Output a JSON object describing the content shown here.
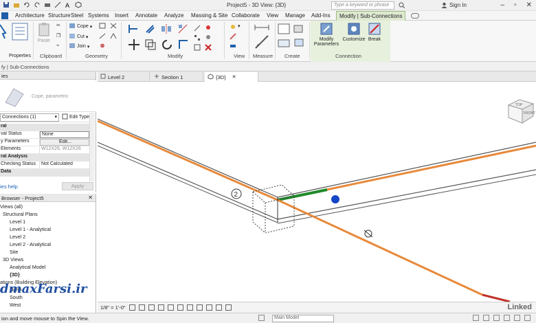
{
  "title_bar": {
    "document_title": "Project5 - 3D View: {3D}",
    "search_placeholder": "Type a keyword or phrase",
    "sign_in": "Sign In"
  },
  "ribbon_tabs": [
    "Architecture",
    "Structure",
    "Steel",
    "Systems",
    "Insert",
    "Annotate",
    "Analyze",
    "Massing & Site",
    "Collaborate",
    "View",
    "Manage",
    "Add-Ins",
    "Modify | Sub-Connections"
  ],
  "ribbon": {
    "properties_label": "Properties",
    "clipboard": {
      "paste": "Paste",
      "group": "Clipboard"
    },
    "geometry": {
      "cope": "Cope",
      "cut": "Cut",
      "join": "Join",
      "group": "Geometry"
    },
    "modify_group": "Modify",
    "view_group": "View",
    "measure_group": "Measure",
    "create_group": "Create",
    "connection": {
      "modify_parameters_1": "Modify",
      "modify_parameters_2": "Parameters",
      "customize": "Customize",
      "break": "Break",
      "group": "Connection"
    }
  },
  "context_bar": "fy | Sub-Connections",
  "properties": {
    "header": "ies",
    "type_name": "Cope, parametric",
    "instance_selector": "Connections (1)",
    "edit_type": "Edit Type",
    "rows": [
      {
        "section": true,
        "key": "ral"
      },
      {
        "key": "val Status",
        "value": "None",
        "style": "boxed"
      },
      {
        "key": "y Parameters",
        "value": "Edit...",
        "style": "btn"
      },
      {
        "key": "Elements",
        "value": "W12X26, W12X26",
        "style": "gray"
      },
      {
        "section": true,
        "key": "ral Analysis"
      },
      {
        "key": "Checking Status",
        "value": "Not Calculated",
        "style": ""
      },
      {
        "section": true,
        "key": "Data"
      }
    ],
    "help_link": "ies help",
    "apply": "Apply"
  },
  "project_browser": {
    "header": "Browser - Project5",
    "items": [
      {
        "label": "Views (all)",
        "level": "l0"
      },
      {
        "label": "Structural Plans",
        "level": "l1"
      },
      {
        "label": "Level 1",
        "level": "l2"
      },
      {
        "label": "Level 1 - Analytical",
        "level": "l2"
      },
      {
        "label": "Level 2",
        "level": "l2"
      },
      {
        "label": "Level 2 - Analytical",
        "level": "l2"
      },
      {
        "label": "Site",
        "level": "l2"
      },
      {
        "label": "3D Views",
        "level": "l1"
      },
      {
        "label": "Analytical Model",
        "level": "l2"
      },
      {
        "label": "{3D}",
        "level": "l2 bold"
      },
      {
        "label": "ations (Building Elevation)",
        "level": "l0"
      },
      {
        "label": "North",
        "level": "l2"
      },
      {
        "label": "South",
        "level": "l2"
      },
      {
        "label": "West",
        "level": "l2"
      }
    ],
    "watermark": "dmaxFarsi.ir"
  },
  "view_tabs": [
    {
      "label": "Level 2",
      "active": false
    },
    {
      "label": "Section 1",
      "active": false
    },
    {
      "label": "{3D}",
      "active": true
    }
  ],
  "view": {
    "viewcube_top": "TOP",
    "viewcube_front": "FRONT",
    "tag_number": "2"
  },
  "view_control": {
    "scale": "1/8\" = 1'-0\"",
    "linkedin": "Linked"
  },
  "status_bar": {
    "text": "ion and move mouse to Spin the View.",
    "model": "Main Model"
  },
  "colors": {
    "accent_tab": "#dfe9d2",
    "beam_orange": "#e8893a",
    "beam_green": "#1f8a2a",
    "pivot_blue": "#1646c8"
  }
}
